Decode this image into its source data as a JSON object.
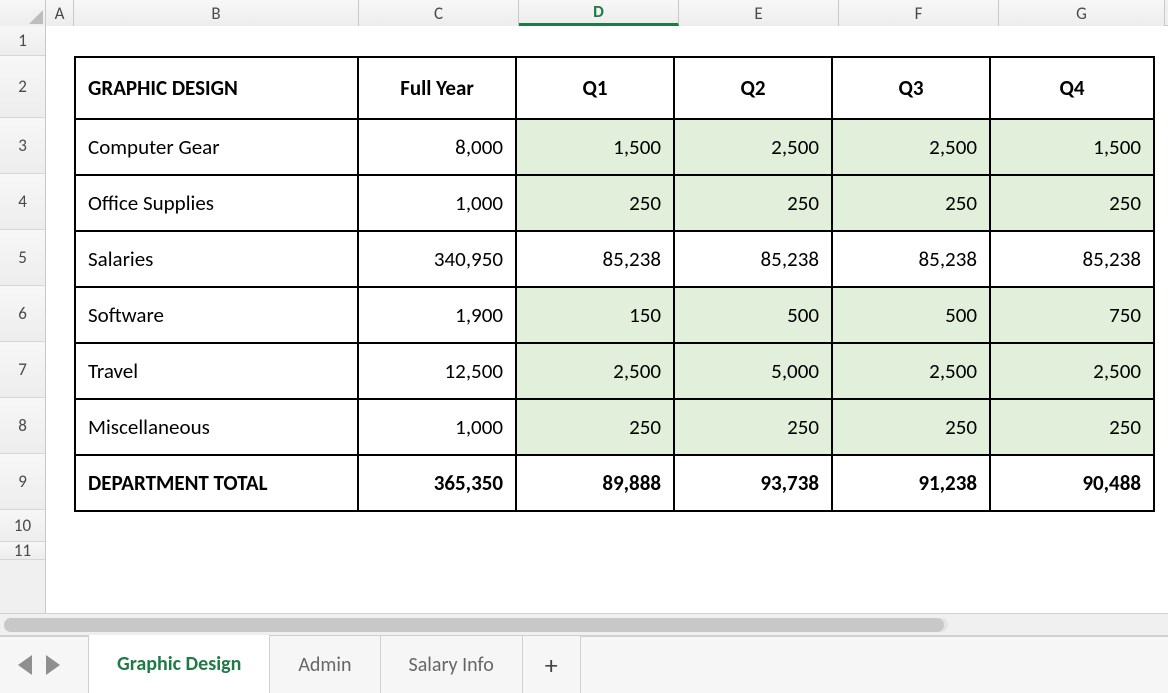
{
  "columns": {
    "A": "A",
    "B": "B",
    "C": "C",
    "D": "D",
    "E": "E",
    "F": "F",
    "G": "G"
  },
  "active_column": "D",
  "rows_visible": [
    "1",
    "2",
    "3",
    "4",
    "5",
    "6",
    "7",
    "8",
    "9",
    "10",
    "11"
  ],
  "table": {
    "title": "GRAPHIC DESIGN",
    "headers": {
      "full_year": "Full Year",
      "q1": "Q1",
      "q2": "Q2",
      "q3": "Q3",
      "q4": "Q4"
    },
    "rows": [
      {
        "label": "Computer Gear",
        "full_year": "8,000",
        "q1": "1,500",
        "q2": "2,500",
        "q3": "2,500",
        "q4": "1,500",
        "highlight": true
      },
      {
        "label": "Office Supplies",
        "full_year": "1,000",
        "q1": "250",
        "q2": "250",
        "q3": "250",
        "q4": "250",
        "highlight": true
      },
      {
        "label": "Salaries",
        "full_year": "340,950",
        "q1": "85,238",
        "q2": "85,238",
        "q3": "85,238",
        "q4": "85,238",
        "highlight": false
      },
      {
        "label": "Software",
        "full_year": "1,900",
        "q1": "150",
        "q2": "500",
        "q3": "500",
        "q4": "750",
        "highlight": true
      },
      {
        "label": "Travel",
        "full_year": "12,500",
        "q1": "2,500",
        "q2": "5,000",
        "q3": "2,500",
        "q4": "2,500",
        "highlight": true
      },
      {
        "label": "Miscellaneous",
        "full_year": "1,000",
        "q1": "250",
        "q2": "250",
        "q3": "250",
        "q4": "250",
        "highlight": true
      }
    ],
    "total": {
      "label": "DEPARTMENT TOTAL",
      "full_year": "365,350",
      "q1": "89,888",
      "q2": "93,738",
      "q3": "91,238",
      "q4": "90,488"
    }
  },
  "tabs": {
    "items": [
      {
        "label": "Graphic Design",
        "active": true
      },
      {
        "label": "Admin",
        "active": false
      },
      {
        "label": "Salary Info",
        "active": false
      }
    ],
    "add_label": "+"
  }
}
